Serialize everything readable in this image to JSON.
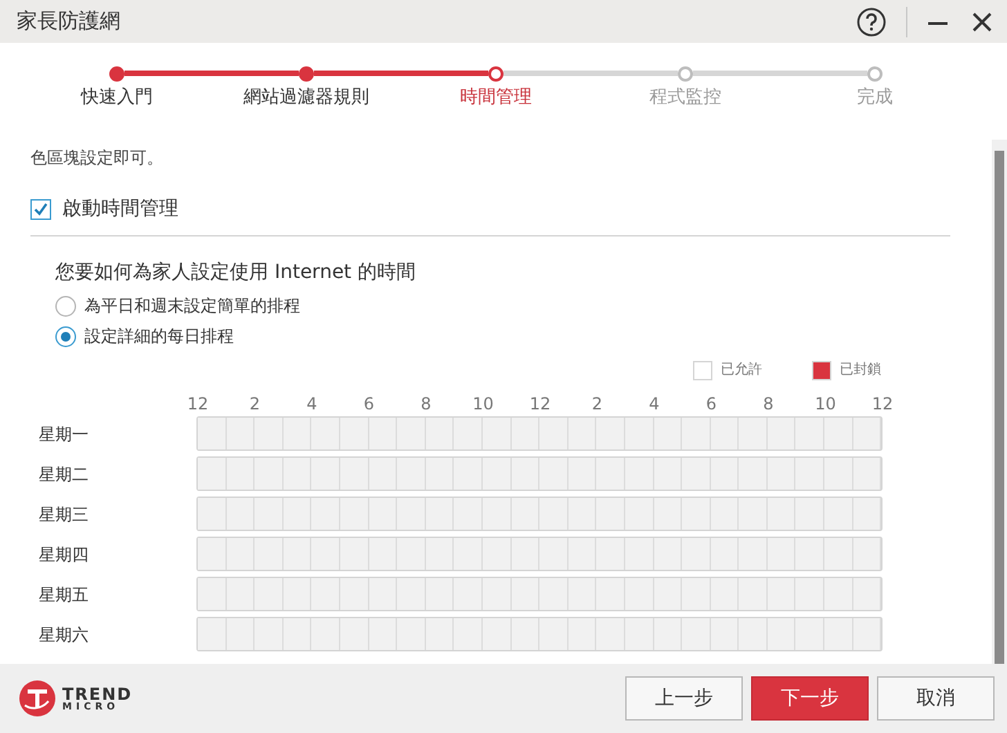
{
  "window": {
    "title": "家長防護網"
  },
  "steps": [
    {
      "label": "快速入門",
      "completed": true,
      "selected": false
    },
    {
      "label": "網站過濾器規則",
      "completed": true,
      "selected": false
    },
    {
      "label": "時間管理",
      "completed": false,
      "selected": true
    },
    {
      "label": "程式監控",
      "completed": false,
      "selected": false
    },
    {
      "label": "完成",
      "completed": false,
      "selected": false
    }
  ],
  "intro_text": "色區塊設定即可。",
  "enable": {
    "label": "啟動時間管理",
    "checked": true
  },
  "question": "您要如何為家人設定使用 Internet 的時間",
  "options": [
    {
      "label": "為平日和週末設定簡單的排程",
      "selected": false
    },
    {
      "label": "設定詳細的每日排程",
      "selected": true
    }
  ],
  "legend": [
    {
      "label": "已允許",
      "color": "#ffffff"
    },
    {
      "label": "已封鎖",
      "color": "#d9343f"
    }
  ],
  "hour_labels": [
    "12",
    "2",
    "4",
    "6",
    "8",
    "10",
    "12",
    "2",
    "4",
    "6",
    "8",
    "10",
    "12"
  ],
  "schedule": [
    {
      "day": "星期一",
      "cells": [
        {
          "blocked": false
        },
        {
          "blocked": false
        },
        {
          "blocked": false
        },
        {
          "blocked": false
        },
        {
          "blocked": false
        },
        {
          "blocked": false
        },
        {
          "blocked": false
        },
        {
          "blocked": false
        },
        {
          "blocked": false
        },
        {
          "blocked": false
        },
        {
          "blocked": false
        },
        {
          "blocked": false
        },
        {
          "blocked": false
        },
        {
          "blocked": false
        },
        {
          "blocked": false
        },
        {
          "blocked": false
        },
        {
          "blocked": false
        },
        {
          "blocked": false
        },
        {
          "blocked": false
        },
        {
          "blocked": false
        },
        {
          "blocked": false
        },
        {
          "blocked": false
        },
        {
          "blocked": false
        },
        {
          "blocked": false
        }
      ]
    },
    {
      "day": "星期二",
      "cells": [
        {
          "blocked": false
        },
        {
          "blocked": false
        },
        {
          "blocked": false
        },
        {
          "blocked": false
        },
        {
          "blocked": false
        },
        {
          "blocked": false
        },
        {
          "blocked": false
        },
        {
          "blocked": false
        },
        {
          "blocked": false
        },
        {
          "blocked": false
        },
        {
          "blocked": false
        },
        {
          "blocked": false
        },
        {
          "blocked": false
        },
        {
          "blocked": false
        },
        {
          "blocked": false
        },
        {
          "blocked": false
        },
        {
          "blocked": false
        },
        {
          "blocked": false
        },
        {
          "blocked": false
        },
        {
          "blocked": false
        },
        {
          "blocked": false
        },
        {
          "blocked": false
        },
        {
          "blocked": false
        },
        {
          "blocked": false
        }
      ]
    },
    {
      "day": "星期三",
      "cells": [
        {
          "blocked": false
        },
        {
          "blocked": false
        },
        {
          "blocked": false
        },
        {
          "blocked": false
        },
        {
          "blocked": false
        },
        {
          "blocked": false
        },
        {
          "blocked": false
        },
        {
          "blocked": false
        },
        {
          "blocked": false
        },
        {
          "blocked": false
        },
        {
          "blocked": false
        },
        {
          "blocked": false
        },
        {
          "blocked": false
        },
        {
          "blocked": false
        },
        {
          "blocked": false
        },
        {
          "blocked": false
        },
        {
          "blocked": false
        },
        {
          "blocked": false
        },
        {
          "blocked": false
        },
        {
          "blocked": false
        },
        {
          "blocked": false
        },
        {
          "blocked": false
        },
        {
          "blocked": false
        },
        {
          "blocked": false
        }
      ]
    },
    {
      "day": "星期四",
      "cells": [
        {
          "blocked": false
        },
        {
          "blocked": false
        },
        {
          "blocked": false
        },
        {
          "blocked": false
        },
        {
          "blocked": false
        },
        {
          "blocked": false
        },
        {
          "blocked": false
        },
        {
          "blocked": false
        },
        {
          "blocked": false
        },
        {
          "blocked": false
        },
        {
          "blocked": false
        },
        {
          "blocked": false
        },
        {
          "blocked": false
        },
        {
          "blocked": false
        },
        {
          "blocked": false
        },
        {
          "blocked": false
        },
        {
          "blocked": false
        },
        {
          "blocked": false
        },
        {
          "blocked": false
        },
        {
          "blocked": false
        },
        {
          "blocked": false
        },
        {
          "blocked": false
        },
        {
          "blocked": false
        },
        {
          "blocked": false
        }
      ]
    },
    {
      "day": "星期五",
      "cells": [
        {
          "blocked": false
        },
        {
          "blocked": false
        },
        {
          "blocked": false
        },
        {
          "blocked": false
        },
        {
          "blocked": false
        },
        {
          "blocked": false
        },
        {
          "blocked": false
        },
        {
          "blocked": false
        },
        {
          "blocked": false
        },
        {
          "blocked": false
        },
        {
          "blocked": false
        },
        {
          "blocked": false
        },
        {
          "blocked": false
        },
        {
          "blocked": false
        },
        {
          "blocked": false
        },
        {
          "blocked": false
        },
        {
          "blocked": false
        },
        {
          "blocked": false
        },
        {
          "blocked": false
        },
        {
          "blocked": false
        },
        {
          "blocked": false
        },
        {
          "blocked": false
        },
        {
          "blocked": false
        },
        {
          "blocked": false
        }
      ]
    },
    {
      "day": "星期六",
      "cells": [
        {
          "blocked": false
        },
        {
          "blocked": false
        },
        {
          "blocked": false
        },
        {
          "blocked": false
        },
        {
          "blocked": false
        },
        {
          "blocked": false
        },
        {
          "blocked": false
        },
        {
          "blocked": false
        },
        {
          "blocked": false
        },
        {
          "blocked": false
        },
        {
          "blocked": false
        },
        {
          "blocked": false
        },
        {
          "blocked": false
        },
        {
          "blocked": false
        },
        {
          "blocked": false
        },
        {
          "blocked": false
        },
        {
          "blocked": false
        },
        {
          "blocked": false
        },
        {
          "blocked": false
        },
        {
          "blocked": false
        },
        {
          "blocked": false
        },
        {
          "blocked": false
        },
        {
          "blocked": false
        },
        {
          "blocked": false
        }
      ]
    }
  ],
  "logo": {
    "line_1": "TREND",
    "line_2": "MICRO"
  },
  "buttons": [
    {
      "label": "上一步",
      "kind": "secondary"
    },
    {
      "label": "下一步",
      "kind": "primary"
    },
    {
      "label": "取消",
      "kind": "secondary"
    }
  ]
}
